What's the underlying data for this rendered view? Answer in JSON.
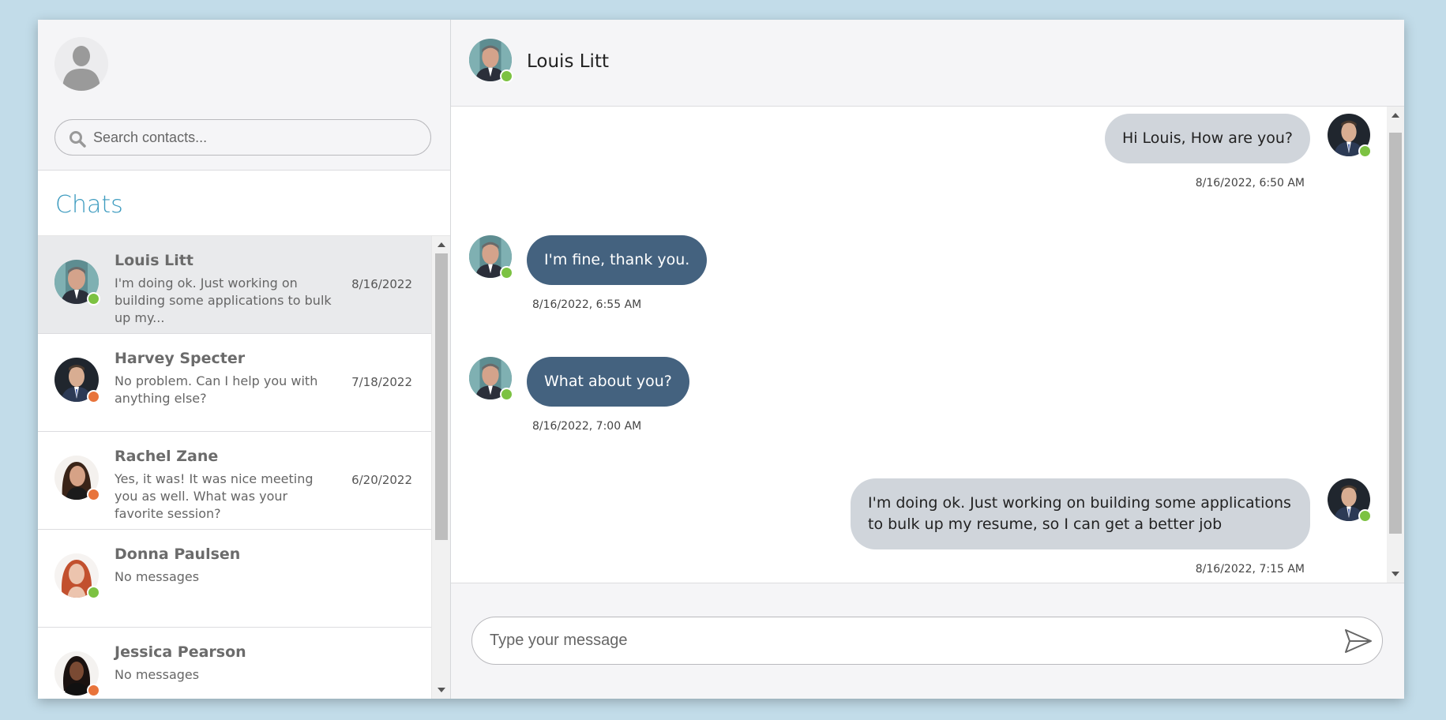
{
  "sidebar": {
    "search_placeholder": "Search contacts...",
    "chats_title": "Chats",
    "contacts": [
      {
        "name": "Louis Litt",
        "preview": "I'm doing ok. Just working on building some applications to bulk up my...",
        "date": "8/16/2022",
        "status": "online",
        "active": true
      },
      {
        "name": "Harvey Specter",
        "preview": "No problem. Can I help you with anything else?",
        "date": "7/18/2022",
        "status": "away"
      },
      {
        "name": "Rachel Zane",
        "preview": "Yes, it was! It was nice meeting you as well. What was your favorite session?",
        "date": "6/20/2022",
        "status": "away"
      },
      {
        "name": "Donna Paulsen",
        "preview": "No messages",
        "date": "",
        "status": "online"
      },
      {
        "name": "Jessica Pearson",
        "preview": "No messages",
        "date": "",
        "status": "away"
      }
    ]
  },
  "chat": {
    "contact_name": "Louis Litt",
    "messages": [
      {
        "direction": "out",
        "text": "Hi Louis, How are you?",
        "timestamp": "8/16/2022, 6:50 AM"
      },
      {
        "direction": "in",
        "text": "I'm fine, thank you.",
        "timestamp": "8/16/2022, 6:55 AM"
      },
      {
        "direction": "in",
        "text": "What about you?",
        "timestamp": "8/16/2022, 7:00 AM"
      },
      {
        "direction": "out",
        "text": "I'm doing ok. Just working on building some applications to bulk up my resume, so I can get a better job",
        "timestamp": "8/16/2022, 7:15 AM"
      }
    ]
  },
  "composer": {
    "placeholder": "Type your message"
  },
  "colors": {
    "accent": "#3d9bbf",
    "incoming_bubble": "#44627f",
    "outgoing_bubble": "#d0d5db",
    "online": "#7cc242",
    "away": "#e8743b"
  },
  "icons": {
    "search": "search-icon",
    "send": "send-icon",
    "profile": "user-silhouette-icon"
  }
}
